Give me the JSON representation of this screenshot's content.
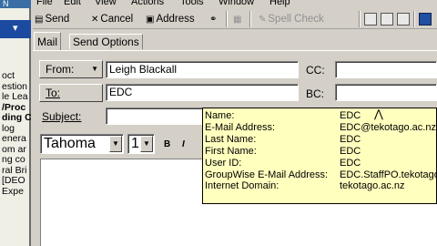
{
  "background_window": {
    "title": "N",
    "band_arrow": "▾",
    "items": [
      "oct",
      "estion",
      "le Lea",
      "/Proc",
      "ding C",
      "log",
      "enera",
      "om ar",
      "ng co",
      "ral Bri",
      "[DEO",
      "Expe"
    ],
    "bold_items": [
      3,
      4
    ]
  },
  "menu": [
    "File",
    "Edit",
    "View",
    "Actions",
    "Tools",
    "Window",
    "Help"
  ],
  "toolbar": {
    "send": "Send",
    "cancel": "Cancel",
    "address": "Address",
    "spell_check": "Spell Check"
  },
  "tabs": {
    "mail": "Mail",
    "send_options": "Send Options"
  },
  "form": {
    "from_label": "From:",
    "from_value": "Leigh Blackall",
    "to_label": "To:",
    "to_value": "EDC",
    "subject_label": "Subject:",
    "subject_value": "",
    "cc_label": "CC:",
    "cc_value": "",
    "bc_label": "BC:",
    "bc_value": ""
  },
  "format": {
    "font": "Tahoma",
    "size": "1",
    "bold": "B",
    "italic": "I"
  },
  "tooltip": {
    "rows": [
      {
        "label": "Name:",
        "value": "EDC"
      },
      {
        "label": "E-Mail Address:",
        "value": "EDC@tekotago.ac.nz"
      },
      {
        "label": "Last Name:",
        "value": "EDC"
      },
      {
        "label": "First Name:",
        "value": "EDC"
      },
      {
        "label": "User ID:",
        "value": "EDC"
      },
      {
        "label": "GroupWise E-Mail Address:",
        "value": "EDC.StaffPO.tekotago"
      },
      {
        "label": "Internet Domain:",
        "value": "tekotago.ac.nz"
      }
    ]
  },
  "colors": {
    "window_bg": "#d4d0c8",
    "tooltip_bg": "#ffffbe",
    "selection_blue": "#1c4aa0"
  },
  "icons": [
    "send-icon",
    "cancel-icon",
    "address-book-icon",
    "attach-icon",
    "spell-check-icon"
  ]
}
